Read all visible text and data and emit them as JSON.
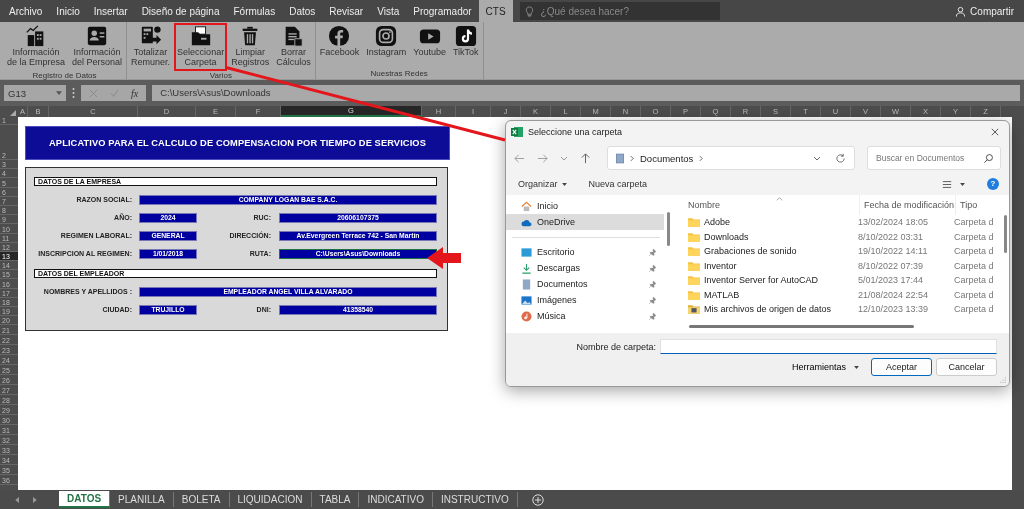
{
  "menu_tabs": [
    {
      "label": "Archivo",
      "selected": false
    },
    {
      "label": "Inicio",
      "selected": false
    },
    {
      "label": "Insertar",
      "selected": false
    },
    {
      "label": "Diseño de página",
      "selected": false
    },
    {
      "label": "Fórmulas",
      "selected": false
    },
    {
      "label": "Datos",
      "selected": false
    },
    {
      "label": "Revisar",
      "selected": false
    },
    {
      "label": "Vista",
      "selected": false
    },
    {
      "label": "Programador",
      "selected": false
    },
    {
      "label": "CTS",
      "selected": true
    }
  ],
  "search": {
    "placeholder": "¿Qué desea hacer?"
  },
  "share": "Compartir",
  "ribbon_groups": [
    {
      "label": "Registro de Datos",
      "buttons": [
        {
          "kind": "building",
          "lines": [
            "Información",
            "de la Empresa"
          ],
          "highlighted": false
        },
        {
          "kind": "id-card",
          "lines": [
            "Información",
            "del Personal"
          ],
          "highlighted": false
        }
      ]
    },
    {
      "label": "Varios",
      "buttons": [
        {
          "kind": "calculator",
          "lines": [
            "Totalizar",
            "Remuner."
          ],
          "highlighted": false
        },
        {
          "kind": "folder",
          "lines": [
            "Seleccionar",
            "Carpeta"
          ],
          "highlighted": true
        },
        {
          "kind": "trash",
          "lines": [
            "Limpiar",
            "Registros"
          ],
          "highlighted": false
        },
        {
          "kind": "document",
          "lines": [
            "Borrar",
            "Cálculos"
          ],
          "highlighted": false
        }
      ]
    },
    {
      "label": "Nuestras Redes",
      "buttons": [
        {
          "kind": "facebook",
          "lines": [
            "Facebook"
          ],
          "highlighted": false
        },
        {
          "kind": "instagram",
          "lines": [
            "Instagram"
          ],
          "highlighted": false
        },
        {
          "kind": "youtube",
          "lines": [
            "Youtube"
          ],
          "highlighted": false
        },
        {
          "kind": "tiktok",
          "lines": [
            "TikTok"
          ],
          "highlighted": false
        }
      ]
    }
  ],
  "formula_bar": {
    "name_box": "G13",
    "function": "fx",
    "formula": "C:\\Users\\Asus\\Downloads"
  },
  "columns": [
    {
      "label": "A",
      "selected": false
    },
    {
      "label": "B",
      "selected": false
    },
    {
      "label": "C",
      "selected": false
    },
    {
      "label": "D",
      "selected": false
    },
    {
      "label": "E",
      "selected": false
    },
    {
      "label": "F",
      "selected": false
    },
    {
      "label": "G",
      "selected": true
    },
    {
      "label": "H",
      "selected": false
    },
    {
      "label": "I",
      "selected": false
    },
    {
      "label": "J",
      "selected": false
    },
    {
      "label": "K",
      "selected": false
    },
    {
      "label": "L",
      "selected": false
    },
    {
      "label": "M",
      "selected": false
    },
    {
      "label": "N",
      "selected": false
    },
    {
      "label": "O",
      "selected": false
    },
    {
      "label": "P",
      "selected": false
    },
    {
      "label": "Q",
      "selected": false
    },
    {
      "label": "R",
      "selected": false
    },
    {
      "label": "S",
      "selected": false
    },
    {
      "label": "T",
      "selected": false
    },
    {
      "label": "U",
      "selected": false
    },
    {
      "label": "V",
      "selected": false
    },
    {
      "label": "W",
      "selected": false
    },
    {
      "label": "X",
      "selected": false
    },
    {
      "label": "Y",
      "selected": false
    },
    {
      "label": "Z",
      "selected": false
    }
  ],
  "rows": [
    {
      "label": "1",
      "selected": false
    },
    {
      "label": "2",
      "selected": false
    },
    {
      "label": "3",
      "selected": false
    },
    {
      "label": "4",
      "selected": false
    },
    {
      "label": "5",
      "selected": false
    },
    {
      "label": "6",
      "selected": false
    },
    {
      "label": "7",
      "selected": false
    },
    {
      "label": "8",
      "selected": false
    },
    {
      "label": "9",
      "selected": false
    },
    {
      "label": "10",
      "selected": false
    },
    {
      "label": "11",
      "selected": false
    },
    {
      "label": "12",
      "selected": false
    },
    {
      "label": "13",
      "selected": true
    },
    {
      "label": "14",
      "selected": false
    },
    {
      "label": "15",
      "selected": false
    },
    {
      "label": "16",
      "selected": false
    },
    {
      "label": "17",
      "selected": false
    },
    {
      "label": "18",
      "selected": false
    },
    {
      "label": "19",
      "selected": false
    },
    {
      "label": "20",
      "selected": false
    },
    {
      "label": "21",
      "selected": false
    },
    {
      "label": "22",
      "selected": false
    },
    {
      "label": "23",
      "selected": false
    },
    {
      "label": "24",
      "selected": false
    },
    {
      "label": "25",
      "selected": false
    },
    {
      "label": "26",
      "selected": false
    },
    {
      "label": "27",
      "selected": false
    },
    {
      "label": "28",
      "selected": false
    },
    {
      "label": "29",
      "selected": false
    },
    {
      "label": "30",
      "selected": false
    },
    {
      "label": "31",
      "selected": false
    },
    {
      "label": "32",
      "selected": false
    },
    {
      "label": "33",
      "selected": false
    },
    {
      "label": "34",
      "selected": false
    },
    {
      "label": "35",
      "selected": false
    },
    {
      "label": "36",
      "selected": false
    }
  ],
  "sheet": {
    "title": "APLICATIVO PARA EL CALCULO DE COMPENSACION POR TIEMPO DE SERVICIOS",
    "sections": [
      {
        "heading": "DATOS DE LA EMPRESA",
        "rows": [
          {
            "fields": [
              {
                "label": "RAZON SOCIAL:",
                "value": "COMPANY LOGAN BAE S.A.C.",
                "selected": false
              }
            ]
          },
          {
            "fields": [
              {
                "label": "AÑO:",
                "value": "2024",
                "selected": false
              },
              {
                "label": "RUC:",
                "value": "20606107375",
                "selected": false
              }
            ]
          },
          {
            "fields": [
              {
                "label": "REGIMEN LABORAL:",
                "value": "GENERAL",
                "selected": false
              },
              {
                "label": "DIRECCIÓN:",
                "value": "Av.Evergreen Terrace 742 - San Martín",
                "selected": false
              }
            ]
          },
          {
            "fields": [
              {
                "label": "INSCRIPCION AL REGIMEN:",
                "value": "1/01/2018",
                "selected": false
              },
              {
                "label": "RUTA:",
                "value": "C:\\Users\\Asus\\Downloads",
                "selected": true
              }
            ]
          }
        ]
      },
      {
        "heading": "DATOS DEL EMPLEADOR",
        "rows": [
          {
            "fields": [
              {
                "label": "NOMBRES Y APELLIDOS :",
                "value": "EMPLEADOR ANGEL VILLA ALVARADO",
                "selected": false
              }
            ]
          },
          {
            "fields": [
              {
                "label": "CIUDAD:",
                "value": "TRUJILLO",
                "selected": false
              },
              {
                "label": "DNI:",
                "value": "41358540",
                "selected": false
              }
            ]
          }
        ]
      }
    ]
  },
  "dialog": {
    "title": "Seleccione una carpeta",
    "path": "Documentos",
    "search_placeholder": "Buscar en Documentos",
    "toolbar": {
      "organize": "Organizar",
      "new_folder": "Nueva carpeta",
      "help": "?"
    },
    "nav_groups": [
      {
        "items": [
          {
            "label": "Inicio",
            "kind": "home",
            "pinned": false,
            "selected": false
          },
          {
            "label": "OneDrive",
            "kind": "cloud",
            "pinned": false,
            "selected": true
          }
        ]
      },
      {
        "items": [
          {
            "label": "Escritorio",
            "kind": "desktop",
            "pinned": true,
            "selected": false
          },
          {
            "label": "Descargas",
            "kind": "download",
            "pinned": true,
            "selected": false
          },
          {
            "label": "Documentos",
            "kind": "document",
            "pinned": true,
            "selected": false
          },
          {
            "label": "Imágenes",
            "kind": "image",
            "pinned": true,
            "selected": false
          },
          {
            "label": "Música",
            "kind": "music",
            "pinned": true,
            "selected": false
          }
        ]
      }
    ],
    "columns": [
      "Nombre",
      "Fecha de modificación",
      "Tipo"
    ],
    "files": [
      {
        "name": "Adobe",
        "date": "13/02/2024 18:05",
        "type": "Carpeta d",
        "kind": "folder"
      },
      {
        "name": "Downloads",
        "date": "8/10/2022 03:31",
        "type": "Carpeta d",
        "kind": "folder"
      },
      {
        "name": "Grabaciones de sonido",
        "date": "19/10/2022 14:11",
        "type": "Carpeta d",
        "kind": "folder"
      },
      {
        "name": "Inventor",
        "date": "8/10/2022 07:39",
        "type": "Carpeta d",
        "kind": "folder"
      },
      {
        "name": "Inventor Server for AutoCAD",
        "date": "5/01/2023 17:44",
        "type": "Carpeta d",
        "kind": "folder"
      },
      {
        "name": "MATLAB",
        "date": "21/08/2024 22:54",
        "type": "Carpeta d",
        "kind": "folder"
      },
      {
        "name": "Mis archivos de origen de datos",
        "date": "12/10/2023 13:39",
        "type": "Carpeta d",
        "kind": "special"
      }
    ],
    "folder_name_label": "Nombre de carpeta:",
    "tools": "Herramientas",
    "buttons": [
      {
        "label": "Aceptar",
        "default": true
      },
      {
        "label": "Cancelar",
        "default": false
      }
    ]
  },
  "sheet_tabs": [
    {
      "label": "DATOS",
      "selected": true
    },
    {
      "label": "PLANILLA",
      "selected": false
    },
    {
      "label": "BOLETA",
      "selected": false
    },
    {
      "label": "LIQUIDACION",
      "selected": false
    },
    {
      "label": "TABLA",
      "selected": false
    },
    {
      "label": "INDICATIVO",
      "selected": false
    },
    {
      "label": "INSTRUCTIVO",
      "selected": false
    }
  ]
}
